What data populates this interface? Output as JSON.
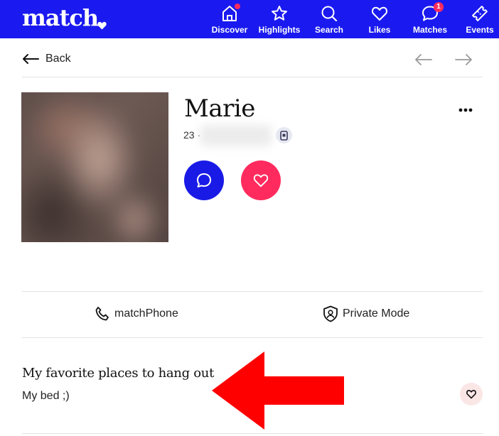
{
  "brand": {
    "logo_text": "match",
    "nav_bg": "#1a1af0",
    "accent_red": "#ff2b5e"
  },
  "nav": {
    "items": [
      {
        "label": "Discover",
        "icon": "home-icon",
        "has_dot": true
      },
      {
        "label": "Highlights",
        "icon": "star-icon"
      },
      {
        "label": "Search",
        "icon": "search-icon"
      },
      {
        "label": "Likes",
        "icon": "heart-icon"
      },
      {
        "label": "Matches",
        "icon": "chat-bubble-icon",
        "badge": "1"
      },
      {
        "label": "Events",
        "icon": "ticket-icon"
      }
    ]
  },
  "back": {
    "label": "Back"
  },
  "profile": {
    "name": "Marie",
    "age_prefix": "23 ·",
    "actions": {
      "message_icon": "chat-bubble-icon",
      "like_icon": "heart-icon"
    }
  },
  "utilities": {
    "match_phone": "matchPhone",
    "private_mode": "Private Mode"
  },
  "prompt": {
    "question": "My favorite places to hang out",
    "answer": "My bed ;)"
  },
  "annotation": {
    "arrow_color": "#ff0000",
    "direction": "left"
  }
}
